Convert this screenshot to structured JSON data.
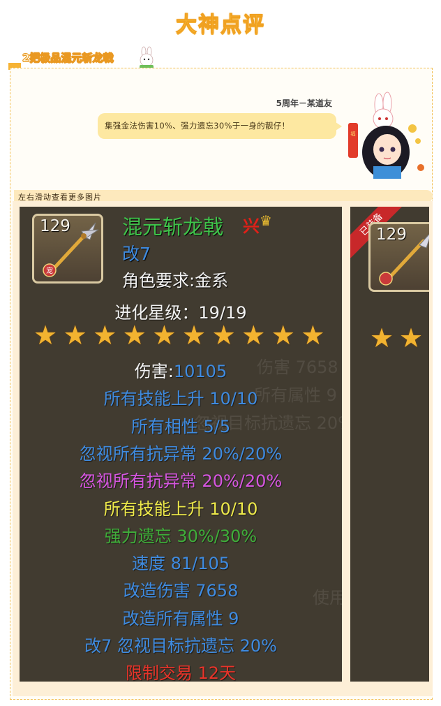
{
  "page": {
    "main_title": "大神点评",
    "section_title": "2把极品混元斩龙戟",
    "author": "5周年－某道友",
    "comment": "集强金法伤害10%、强力遗忘30%于一身的靓仔！",
    "hint": "左右滑动查看更多图片"
  },
  "item": {
    "level": "129",
    "icon_mark": "宠",
    "name": "混元斩龙戟",
    "name_mark": "兴",
    "mod": "改7",
    "requirement": "角色要求:金系",
    "evolution": "进化星级：19/19",
    "stars_count": 10,
    "stats": [
      {
        "text": "伤害:10105",
        "color": "#3f8be0",
        "label_color": "#f2f2f2"
      },
      {
        "text": "所有技能上升 10/10",
        "color": "#3f8be0"
      },
      {
        "text": "所有相性 5/5",
        "color": "#3f8be0"
      },
      {
        "text": "忽视所有抗异常 20%/20%",
        "color": "#3f8be0"
      },
      {
        "text": "忽视所有抗异常 20%/20%",
        "color": "#d656e0"
      },
      {
        "text": "所有技能上升 10/10",
        "color": "#ede94a"
      },
      {
        "text": "强力遗忘 30%/30%",
        "color": "#3fae3a"
      },
      {
        "text": "速度 81/105",
        "color": "#3f8be0"
      },
      {
        "text": "改造伤害 7658",
        "color": "#3f8be0"
      },
      {
        "text": "改造所有属性 9",
        "color": "#3f8be0"
      },
      {
        "text": "改7 忽视目标抗遗忘 20%",
        "color": "#3f8be0"
      },
      {
        "text": "限制交易 12天",
        "color": "#e8342a"
      }
    ]
  },
  "item2": {
    "level": "129",
    "badge": "已装备"
  },
  "background_text": [
    "伤害 7658",
    "所有属性 9",
    "忽视目标抗遗忘 20%",
    "使用"
  ]
}
